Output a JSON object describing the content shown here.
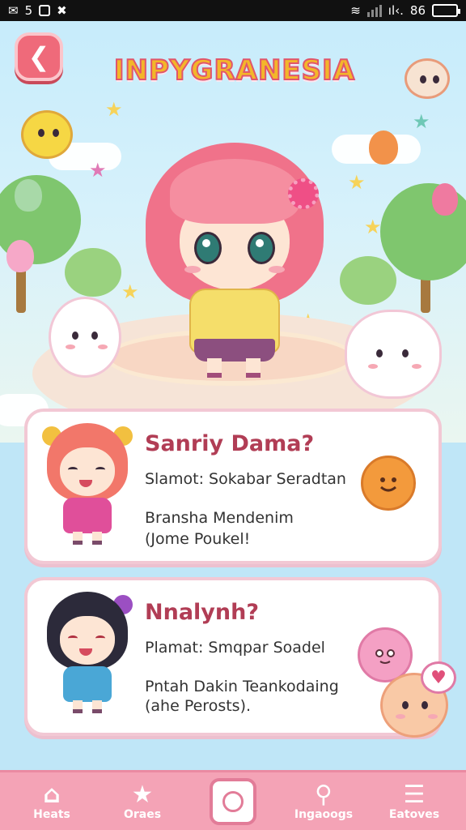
{
  "status_bar": {
    "left_number": "5",
    "right_text": "86"
  },
  "header": {
    "title": "INPYGRANESIA",
    "back_icon": "arrow-left-icon"
  },
  "cards": [
    {
      "title": "Sanriy Dama?",
      "line1": "Slamot: Sokabar Seradtan",
      "line2": "Bransha Mendenim",
      "line3": "(Jome Poukel!",
      "avatar_hair_color": "#f2776a",
      "avatar_outfit_color": "#e04f9a",
      "badge_icon": "smiley-face-icon"
    },
    {
      "title": "Nnalynh?",
      "line1": "Plamat: Smqpar Soadel",
      "line2": "Pntah Dakin Teankodaing",
      "line3": "(ahe Perosts).",
      "avatar_hair_color": "#2c2a3a",
      "avatar_outfit_color": "#4aa7d6",
      "badge_icon": "pink-creature-icon"
    }
  ],
  "bottom_nav": [
    {
      "label": "Heats",
      "icon": "home-icon"
    },
    {
      "label": "Oraes",
      "icon": "star-icon"
    },
    {
      "label": "",
      "icon": "camera-icon"
    },
    {
      "label": "Ingaoogs",
      "icon": "search-icon"
    },
    {
      "label": "Eatoves",
      "icon": "menu-icon"
    }
  ],
  "colors": {
    "accent": "#f4a3b6",
    "card_title": "#b13d55",
    "back_button": "#ef6a7a",
    "sky": "#c7ecfb"
  }
}
